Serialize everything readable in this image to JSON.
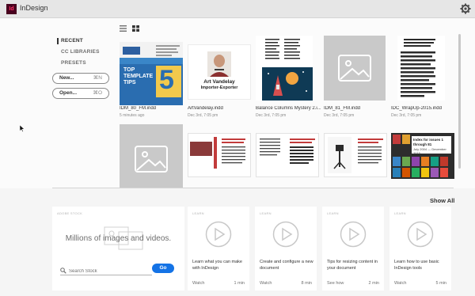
{
  "app": {
    "logo": "Id",
    "title": "InDesign"
  },
  "nav": {
    "items": [
      "RECENT",
      "CC LIBRARIES",
      "PRESETS"
    ]
  },
  "buttons": {
    "new_label": "New...",
    "new_shortcut": "⌘N",
    "open_label": "Open...",
    "open_shortcut": "⌘O"
  },
  "files": [
    {
      "name": "IDM_80_FM.indd",
      "date": "5 minutes ago"
    },
    {
      "name": "ArtVandelay.indd",
      "date": "Dec 3rd, 7:05 pm"
    },
    {
      "name": "Balance Columns Mystery 2.i...",
      "date": "Dec 3rd, 7:05 pm"
    },
    {
      "name": "IDM_81_FM.indd",
      "date": "Dec 3rd, 7:05 pm"
    },
    {
      "name": "IDC_WrapUp-2015.indd",
      "date": "Dec 3rd, 7:05 pm"
    }
  ],
  "thumbnail_text": {
    "top_tips": "TOP TEMPLATE TIPS",
    "five": "5",
    "art_name": "Art Vandelay",
    "art_role": "Importer-Exporter",
    "mag_title": "Index for issues 1 through 81",
    "mag_dates": "July 2004 — December 2015"
  },
  "section": {
    "show_all": "Show All"
  },
  "stock": {
    "caption": "ADOBE STOCK",
    "headline": "Millions of images and videos.",
    "search_placeholder": "Search Stock",
    "go_label": "Go"
  },
  "learn": [
    {
      "caption": "LEARN",
      "title": "Learn what you can make with InDesign",
      "action": "Watch",
      "duration": "1 min"
    },
    {
      "caption": "LEARN",
      "title": "Create and configure a new document",
      "action": "Watch",
      "duration": "8 min"
    },
    {
      "caption": "LEARN",
      "title": "Tips for resizing content in your document",
      "action": "See how",
      "duration": "2 min"
    },
    {
      "caption": "LEARN",
      "title": "Learn how to use basic InDesign tools",
      "action": "Watch",
      "duration": "5 min"
    }
  ],
  "colors": {
    "accent": "#1473e6",
    "brand": "#ff3366",
    "brand_bg": "#49021f",
    "placeholder": "#c9c9c9"
  }
}
